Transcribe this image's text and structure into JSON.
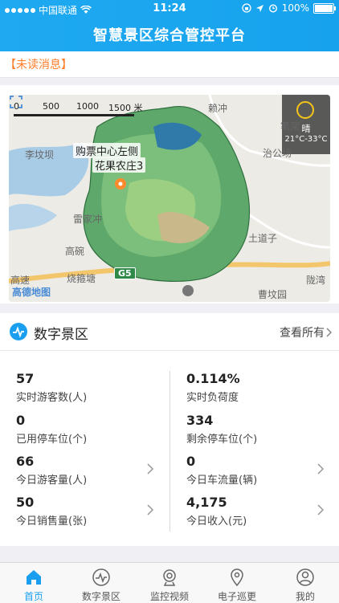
{
  "status_bar": {
    "carrier": "中国联通",
    "time": "11:24",
    "battery": "100%"
  },
  "header": {
    "title": "智慧景区综合管控平台"
  },
  "notice": {
    "label": "【未读消息】"
  },
  "map": {
    "scale_labels": [
      "0",
      "500",
      "1000",
      "1500 米"
    ],
    "poi_1": "购票中心左侧",
    "poi_2": "花果农庄3",
    "weather": {
      "condition": "晴",
      "temperature": "21°C-33°C"
    },
    "place_names": {
      "laijong": "赖冲",
      "bijia": "笔架",
      "zhigong": "治公场",
      "liduo": "李坟坝",
      "leijia": "雷家冲",
      "gaowan": "高碗",
      "shaoti": "烧箍塘",
      "gaosu": "高速",
      "tudaozi": "土道子",
      "caofen": "曹坟园",
      "longwan": "陇湾"
    },
    "highway": "G5",
    "logo": "高德地图"
  },
  "digital": {
    "title": "数字景区",
    "view_all": "查看所有",
    "stats": [
      {
        "value": "57",
        "label": "实时游客数(人)"
      },
      {
        "value": "0.114%",
        "label": "实时负荷度"
      },
      {
        "value": "0",
        "label": "已用停车位(个)"
      },
      {
        "value": "334",
        "label": "剩余停车位(个)"
      },
      {
        "value": "66",
        "label": "今日游客量(人)"
      },
      {
        "value": "0",
        "label": "今日车流量(辆)"
      },
      {
        "value": "50",
        "label": "今日销售量(张)"
      },
      {
        "value": "4,175",
        "label": "今日收入(元)"
      }
    ]
  },
  "tabs": [
    {
      "label": "首页",
      "icon": "home-icon",
      "active": true
    },
    {
      "label": "数字景区",
      "icon": "pulse-icon",
      "active": false
    },
    {
      "label": "监控视频",
      "icon": "camera-icon",
      "active": false
    },
    {
      "label": "电子巡更",
      "icon": "location-pin-icon",
      "active": false
    },
    {
      "label": "我的",
      "icon": "user-icon",
      "active": false
    }
  ],
  "colors": {
    "accent": "#1a9ff0",
    "notice": "#ff7e2b"
  }
}
